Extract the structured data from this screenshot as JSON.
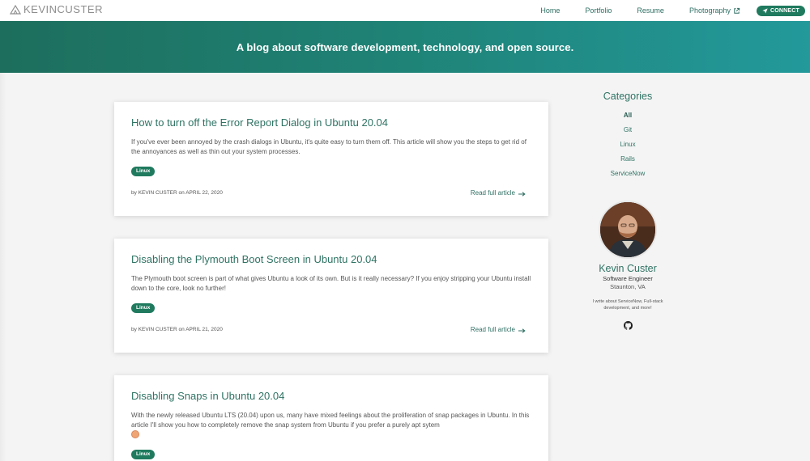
{
  "nav": {
    "brand": "KEVINCUSTER",
    "links": [
      {
        "label": "Home"
      },
      {
        "label": "Portfolio"
      },
      {
        "label": "Resume"
      },
      {
        "label": "Photography"
      }
    ],
    "connect_label": "CONNECT"
  },
  "hero": {
    "tagline": "A blog about software development, technology, and open source."
  },
  "posts": [
    {
      "title": "How to turn off the Error Report Dialog in Ubuntu 20.04",
      "excerpt": "If you've ever been annoyed by the crash dialogs in Ubuntu, it's quite easy to turn them off. This article will show you the steps to get rid of the annoyances as well as thin out your system processes.",
      "tag": "Linux",
      "byline": "by KEVIN CUSTER on APRIL 22, 2020",
      "read_more": "Read full article"
    },
    {
      "title": "Disabling the Plymouth Boot Screen in Ubuntu 20.04",
      "excerpt": "The Plymouth boot screen is part of what gives Ubuntu a look of its own. But is it really necessary? If you enjoy stripping your Ubuntu install down to the core, look no further!",
      "tag": "Linux",
      "byline": "by KEVIN CUSTER on APRIL 21, 2020",
      "read_more": "Read full article"
    },
    {
      "title": "Disabling Snaps in Ubuntu 20.04",
      "excerpt": "With the newly released Ubuntu LTS (20.04) upon us, many have mixed feelings about the proliferation of snap packages in Ubuntu. In this article I'll show you how to completely remove the snap system from Ubuntu if you prefer a purely apt sytem",
      "tag": "Linux"
    }
  ],
  "sidebar": {
    "heading": "Categories",
    "categories": [
      "All",
      "Git",
      "Linux",
      "Rails",
      "ServiceNow"
    ],
    "active_category": "All"
  },
  "profile": {
    "name": "Kevin Custer",
    "role": "Software Engineer",
    "location": "Staunton, VA",
    "bio": "I write about ServiceNow, Full-stack development, and more!"
  },
  "colors": {
    "accent": "#1f7a5e",
    "link": "#2f7363",
    "hero_start": "#1d6e5c",
    "hero_end": "#23999b"
  }
}
